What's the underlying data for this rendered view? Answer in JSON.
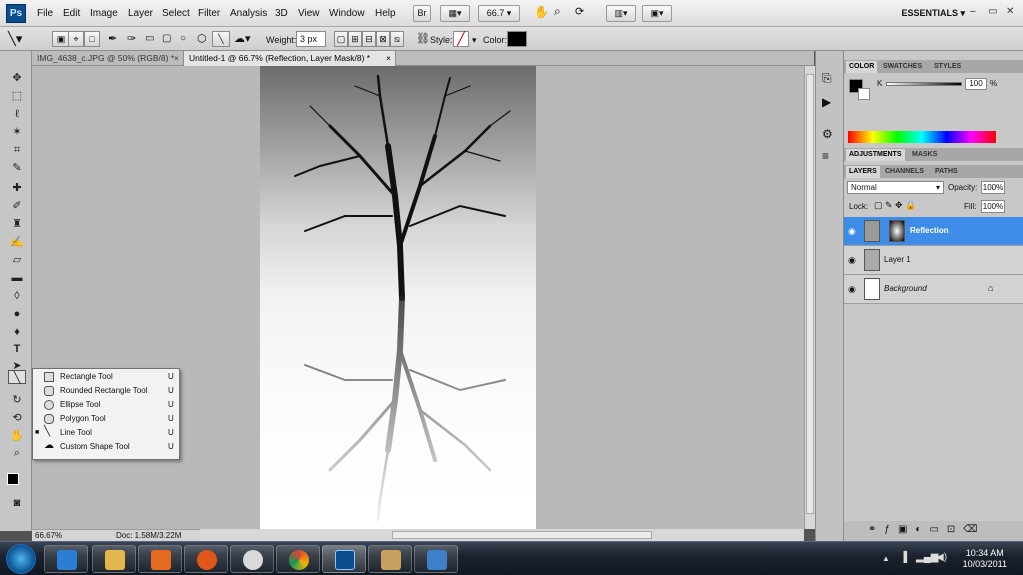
{
  "app": {
    "logo": "Ps"
  },
  "menu": [
    "File",
    "Edit",
    "Image",
    "Layer",
    "Select",
    "Filter",
    "Analysis",
    "3D",
    "View",
    "Window",
    "Help"
  ],
  "menubar": {
    "zoom": "66.7",
    "workspace": "ESSENTIALS",
    "window_controls": [
      "–",
      "▭",
      "✕"
    ]
  },
  "options": {
    "weight_label": "Weight:",
    "weight_value": "3 px",
    "style_label": "Style:",
    "color_label": "Color:",
    "color_value": "#000000"
  },
  "tabs": [
    {
      "label": "IMG_4638_c.JPG @ 50% (RGB/8) *",
      "close": "×"
    },
    {
      "label": "Untitled-1 @ 66.7% (Reflection, Layer Mask/8) *",
      "close": "×"
    }
  ],
  "flyout": {
    "items": [
      {
        "label": "Rectangle Tool",
        "key": "U",
        "icon": "rectangle-icon"
      },
      {
        "label": "Rounded Rectangle Tool",
        "key": "U",
        "icon": "rounded-rectangle-icon"
      },
      {
        "label": "Ellipse Tool",
        "key": "U",
        "icon": "ellipse-icon"
      },
      {
        "label": "Polygon Tool",
        "key": "U",
        "icon": "polygon-icon"
      },
      {
        "label": "Line Tool",
        "key": "U",
        "icon": "line-icon",
        "selected": true
      },
      {
        "label": "Custom Shape Tool",
        "key": "U",
        "icon": "custom-shape-icon"
      }
    ]
  },
  "status": {
    "zoom": "66.67%",
    "doc": "Doc: 1.58M/3.22M"
  },
  "panels": {
    "color_tabs": [
      "COLOR",
      "SWATCHES",
      "STYLES"
    ],
    "color": {
      "channel": "K",
      "value": "100",
      "unit": "%"
    },
    "adjust_tabs": [
      "ADJUSTMENTS",
      "MASKS"
    ],
    "layer_tabs": [
      "LAYERS",
      "CHANNELS",
      "PATHS"
    ],
    "blend_mode": "Normal",
    "opacity_label": "Opacity:",
    "opacity": "100%",
    "lock_label": "Lock:",
    "fill_label": "Fill:",
    "fill": "100%",
    "layers": [
      {
        "name": "Reflection",
        "selected": true
      },
      {
        "name": "Layer 1",
        "selected": false
      },
      {
        "name": "Background",
        "selected": false,
        "locked": true
      }
    ]
  },
  "taskbar": {
    "time": "10:34 AM",
    "date": "10/03/2011"
  },
  "colors": {
    "accent": "#3d8ce8",
    "panel": "#c8c8c8",
    "workspace": "#b9b9b9"
  }
}
